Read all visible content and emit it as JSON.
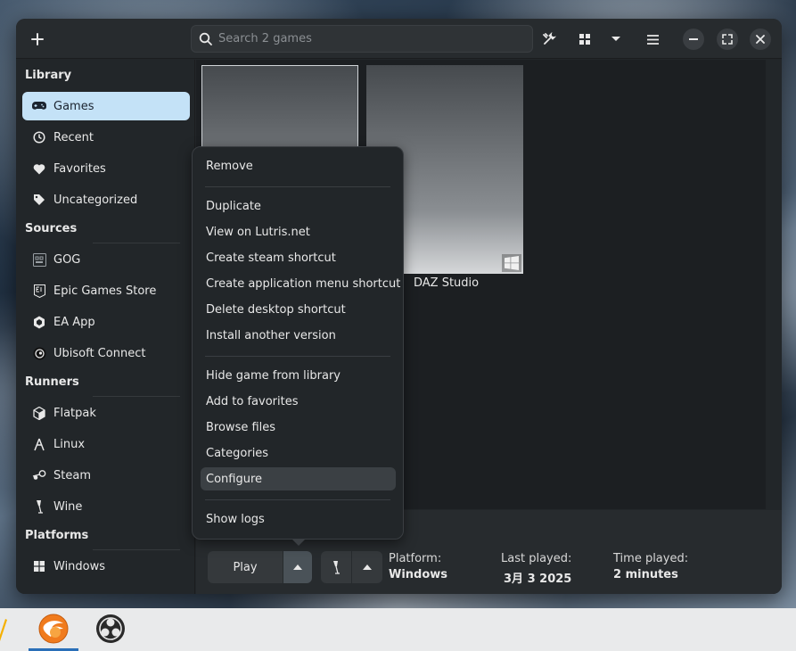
{
  "search": {
    "placeholder": "Search 2 games"
  },
  "sidebar": {
    "library_title": "Library",
    "library_items": [
      {
        "label": "Games",
        "icon": "gamepad-icon"
      },
      {
        "label": "Recent",
        "icon": "clock-icon"
      },
      {
        "label": "Favorites",
        "icon": "heart-icon"
      },
      {
        "label": "Uncategorized",
        "icon": "tag-icon"
      }
    ],
    "sources_title": "Sources",
    "sources_items": [
      {
        "label": "GOG",
        "icon": "gog-icon"
      },
      {
        "label": "Epic Games Store",
        "icon": "epic-icon"
      },
      {
        "label": "EA App",
        "icon": "ea-icon"
      },
      {
        "label": "Ubisoft Connect",
        "icon": "ubisoft-icon"
      }
    ],
    "runners_title": "Runners",
    "runners_items": [
      {
        "label": "Flatpak",
        "icon": "flatpak-icon"
      },
      {
        "label": "Linux",
        "icon": "linux-icon"
      },
      {
        "label": "Steam",
        "icon": "steam-icon"
      },
      {
        "label": "Wine",
        "icon": "wine-icon"
      }
    ],
    "platforms_title": "Platforms",
    "platforms_items": [
      {
        "label": "Windows",
        "icon": "windows-icon"
      }
    ]
  },
  "games": [
    {
      "title": ""
    },
    {
      "title": "DAZ Studio"
    }
  ],
  "context_menu": {
    "items": [
      "Remove",
      "Duplicate",
      "View on Lutris.net",
      "Create steam shortcut",
      "Create application menu shortcut",
      "Delete desktop shortcut",
      "Install another version",
      "Hide game from library",
      "Add to favorites",
      "Browse files",
      "Categories",
      "Configure",
      "Show logs"
    ],
    "highlighted": "Configure"
  },
  "bottom": {
    "play_label": "Play",
    "platform_label": "Platform:",
    "platform_value": "Windows",
    "last_played_label": "Last played:",
    "last_played_value": "3月 3 2025",
    "time_played_label": "Time played:",
    "time_played_value": "2 minutes"
  },
  "colors": {
    "accent_selected": "#c4e2f7",
    "window_bg": "#222629",
    "taskbar_indicator": "#2a6fb8"
  }
}
